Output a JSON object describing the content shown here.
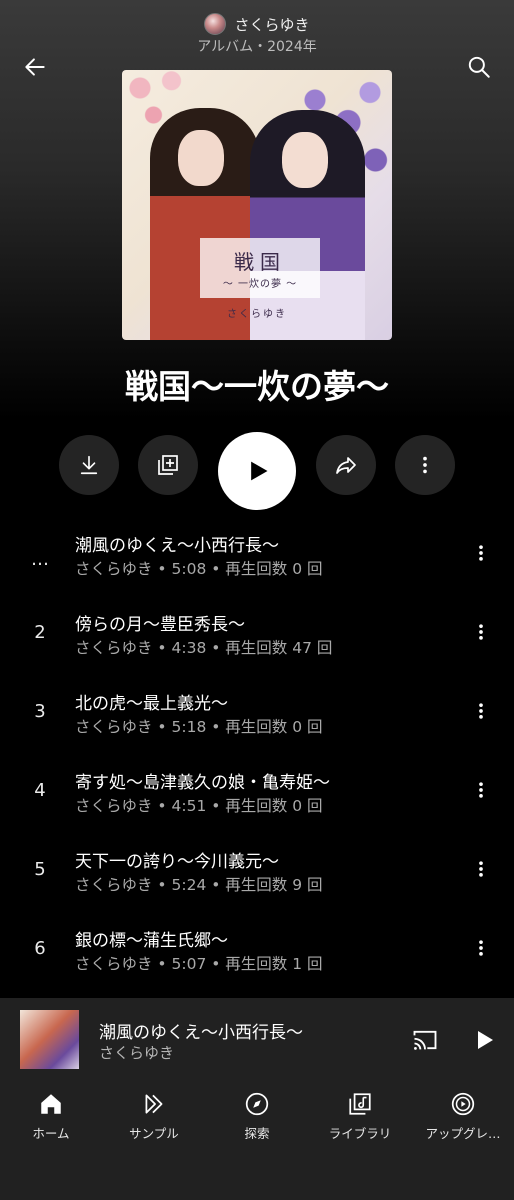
{
  "header": {
    "artist": "さくらゆき",
    "subtitle": "アルバム・2024年"
  },
  "album": {
    "title": "戦国〜一炊の夢〜",
    "cover_title": "戦国",
    "cover_subtitle": "〜 一炊の夢 〜",
    "cover_artist": "さくらゆき"
  },
  "tracks": [
    {
      "number": "…",
      "title": "潮風のゆくえ〜小西行長〜",
      "meta": "さくらゆき • 5:08 • 再生回数 0 回"
    },
    {
      "number": "2",
      "title": "傍らの月〜豊臣秀長〜",
      "meta": "さくらゆき • 4:38 • 再生回数 47 回"
    },
    {
      "number": "3",
      "title": "北の虎〜最上義光〜",
      "meta": "さくらゆき • 5:18 • 再生回数 0 回"
    },
    {
      "number": "4",
      "title": "寄す処〜島津義久の娘・亀寿姫〜",
      "meta": "さくらゆき • 4:51 • 再生回数 0 回"
    },
    {
      "number": "5",
      "title": "天下一の誇り〜今川義元〜",
      "meta": "さくらゆき • 5:24 • 再生回数 9 回"
    },
    {
      "number": "6",
      "title": "銀の標〜蒲生氏郷〜",
      "meta": "さくらゆき • 5:07 • 再生回数 1 回"
    }
  ],
  "mini_player": {
    "title": "潮風のゆくえ〜小西行長〜",
    "artist": "さくらゆき"
  },
  "nav": [
    {
      "label": "ホーム",
      "icon": "home-icon"
    },
    {
      "label": "サンプル",
      "icon": "samples-icon"
    },
    {
      "label": "探索",
      "icon": "explore-icon"
    },
    {
      "label": "ライブラリ",
      "icon": "library-icon"
    },
    {
      "label": "アップグレ…",
      "icon": "upgrade-icon"
    }
  ],
  "colors": {
    "background": "#000000",
    "surface": "#212121",
    "button_bg": "#242424",
    "secondary_text": "#a9a9a9"
  }
}
